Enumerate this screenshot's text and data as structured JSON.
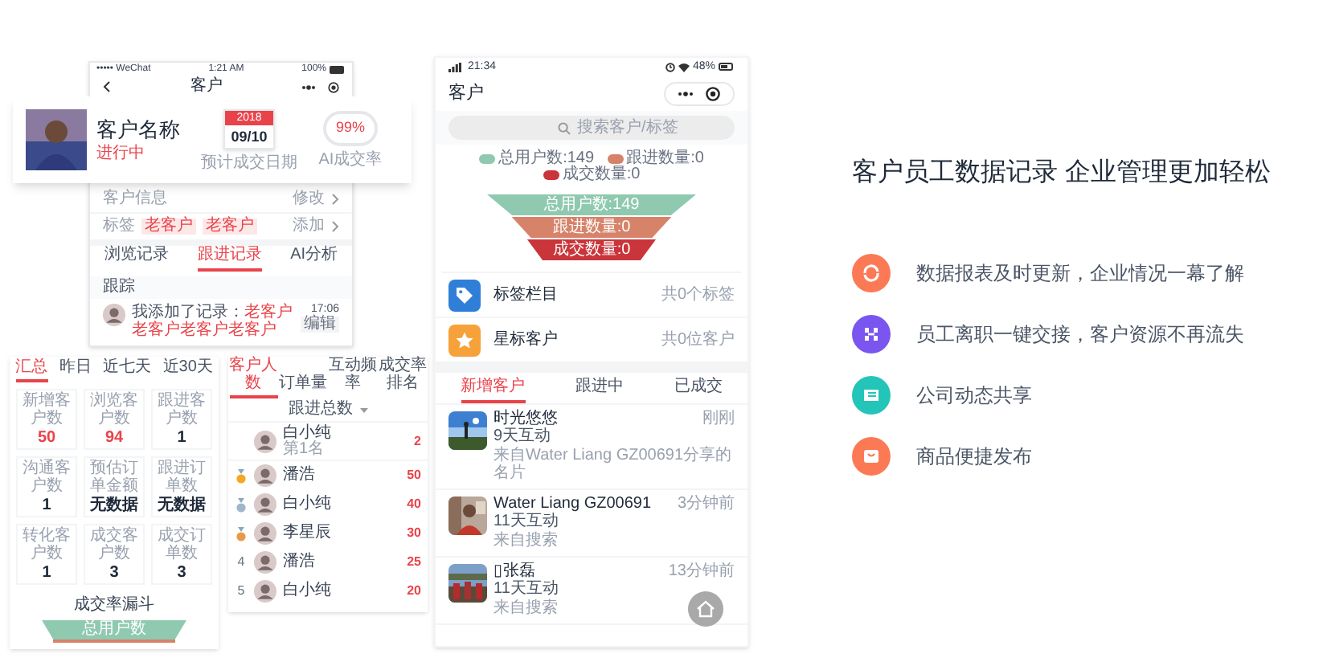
{
  "detail_phone": {
    "status_bar": {
      "carrier": "••••• WeChat",
      "time": "1:21 AM",
      "battery": "100%"
    },
    "title": "客户",
    "rows": [
      {
        "label": "客户信息",
        "tags": [],
        "action": "修改"
      },
      {
        "label": "标签",
        "tags": [
          "老客户",
          "老客户"
        ],
        "action": "添加"
      }
    ],
    "tabs": [
      {
        "label": "浏览记录",
        "selected": false
      },
      {
        "label": "跟进记录",
        "selected": true
      },
      {
        "label": "AI分析",
        "selected": false
      }
    ],
    "section": "跟踪",
    "record": {
      "text": "我添加了记录：",
      "highlight": "老客户老客户老客户老客户",
      "time": "17:06",
      "badge": "编辑"
    }
  },
  "customer_card": {
    "name": "客户名称",
    "status": "进行中",
    "year": "2018",
    "date": "09/10",
    "date_label": "预计成交日期",
    "rate": "99%",
    "rate_label": "AI成交率"
  },
  "stats_card": {
    "tabs": [
      {
        "label": "汇总",
        "selected": true
      },
      {
        "label": "昨日",
        "selected": false
      },
      {
        "label": "近七天",
        "selected": false
      },
      {
        "label": "近30天",
        "selected": false
      }
    ],
    "cells": [
      {
        "label": "新增客户数",
        "value": "50",
        "highlight": true
      },
      {
        "label": "浏览客户数",
        "value": "94",
        "highlight": true
      },
      {
        "label": "跟进客户数",
        "value": "1",
        "highlight": false
      },
      {
        "label": "沟通客户数",
        "value": "1",
        "highlight": false
      },
      {
        "label": "预估订单金额",
        "value": "无数据",
        "highlight": false
      },
      {
        "label": "跟进订单数",
        "value": "无数据",
        "highlight": false
      },
      {
        "label": "转化客户数",
        "value": "1",
        "highlight": false
      },
      {
        "label": "成交客户数",
        "value": "3",
        "highlight": false
      },
      {
        "label": "成交订单数",
        "value": "3",
        "highlight": false
      }
    ],
    "funnel_title": "成交率漏斗",
    "funnel_label": "总用户数"
  },
  "ranking_card": {
    "tabs": [
      {
        "label": "客户人数",
        "selected": true
      },
      {
        "label": "订单量",
        "selected": false
      },
      {
        "label": "互动频率",
        "selected": false
      },
      {
        "label": "成交率排名",
        "selected": false
      }
    ],
    "filter": "跟进总数",
    "rows": [
      {
        "kind": "plain",
        "name": "白小纯",
        "sub": "第1名",
        "value": "2"
      },
      {
        "kind": "medal",
        "color": "#f5a623",
        "name": "潘浩",
        "value": "50"
      },
      {
        "kind": "medal",
        "color": "#9fb6cc",
        "name": "白小纯",
        "value": "40"
      },
      {
        "kind": "medal",
        "color": "#e89a4a",
        "name": "李星辰",
        "value": "30"
      },
      {
        "kind": "number",
        "rank": "4",
        "name": "潘浩",
        "value": "25"
      },
      {
        "kind": "number",
        "rank": "5",
        "name": "白小纯",
        "value": "20"
      }
    ]
  },
  "customers_phone": {
    "status_bar": {
      "time": "21:34",
      "battery": "48%"
    },
    "title": "客户",
    "search": {
      "placeholder": "搜索客户/标签"
    },
    "legend": [
      {
        "label": "总用户数:149",
        "color": "#8fc9b0"
      },
      {
        "label": "跟进数量:0",
        "color": "#d6836a"
      },
      {
        "label": "成交数量:0",
        "color": "#c9353a"
      }
    ],
    "funnel": [
      {
        "label": "总用户数:149",
        "color": "#8fc9b0"
      },
      {
        "label": "跟进数量:0",
        "color": "#d6836a"
      },
      {
        "label": "成交数量:0",
        "color": "#c9353a"
      }
    ],
    "menu": [
      {
        "kind": "tag",
        "label": "标签栏目",
        "info": "共0个标签"
      },
      {
        "kind": "star",
        "label": "星标客户",
        "info": "共0位客户"
      }
    ],
    "tabs": [
      {
        "label": "新增客户",
        "selected": true
      },
      {
        "label": "跟进中",
        "selected": false
      },
      {
        "label": "已成交",
        "selected": false
      }
    ],
    "customers": [
      {
        "name": "时光悠悠",
        "sub": "9天互动",
        "source": "来自Water Liang GZ00691分享的名片",
        "time": "刚刚"
      },
      {
        "name": "Water Liang GZ00691",
        "sub": "11天互动",
        "source": "来自搜索",
        "time": "3分钟前"
      },
      {
        "name": "▯张磊",
        "sub": "11天互动",
        "source": "来自搜索",
        "time": "13分钟前"
      }
    ]
  },
  "features": {
    "title": "客户员工数据记录 企业管理更加轻松",
    "items": [
      {
        "kind": "refresh",
        "text": "数据报表及时更新，企业情况一幕了解",
        "color": "#fb7a55"
      },
      {
        "kind": "transfer",
        "text": "员工离职一键交接，客户资源不再流失",
        "color": "#7a55f0"
      },
      {
        "kind": "news",
        "text": "公司动态共享",
        "color": "#22c5b8"
      },
      {
        "kind": "shop",
        "text": "商品便捷发布",
        "color": "#fb7a55"
      }
    ]
  }
}
